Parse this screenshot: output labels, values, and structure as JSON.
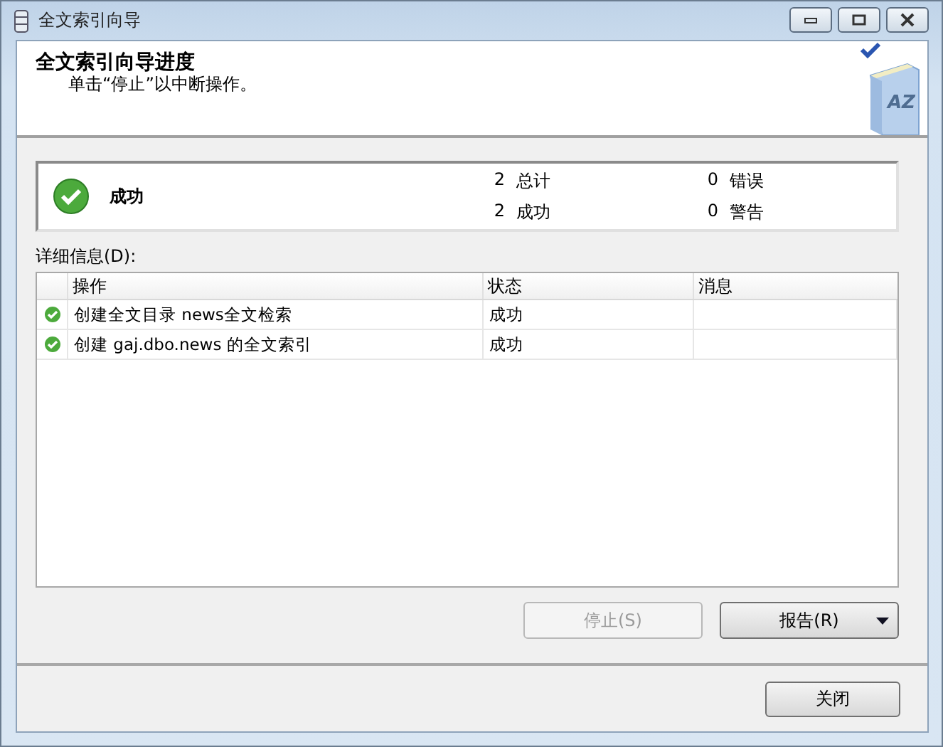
{
  "window": {
    "title": "全文索引向导"
  },
  "header": {
    "title": "全文索引向导进度",
    "subtitle": "单击“停止”以中断操作。",
    "icon_text": "AZ"
  },
  "summary": {
    "status": "成功",
    "stats": [
      {
        "count": "2",
        "label": "总计"
      },
      {
        "count": "0",
        "label": "错误"
      },
      {
        "count": "2",
        "label": "成功"
      },
      {
        "count": "0",
        "label": "警告"
      }
    ]
  },
  "details_label": "详细信息(D):",
  "table": {
    "columns": [
      "操作",
      "状态",
      "消息"
    ],
    "rows": [
      {
        "action": "创建全文目录 news全文检索",
        "status": "成功",
        "message": ""
      },
      {
        "action": "创建 gaj.dbo.news 的全文索引",
        "status": "成功",
        "message": ""
      }
    ]
  },
  "buttons": [
    {
      "label": "停止(S)",
      "disabled": true,
      "kind": "plain"
    },
    {
      "label": "报告(R)",
      "disabled": false,
      "kind": "dropdown"
    }
  ],
  "close_button": {
    "label": "关闭"
  }
}
